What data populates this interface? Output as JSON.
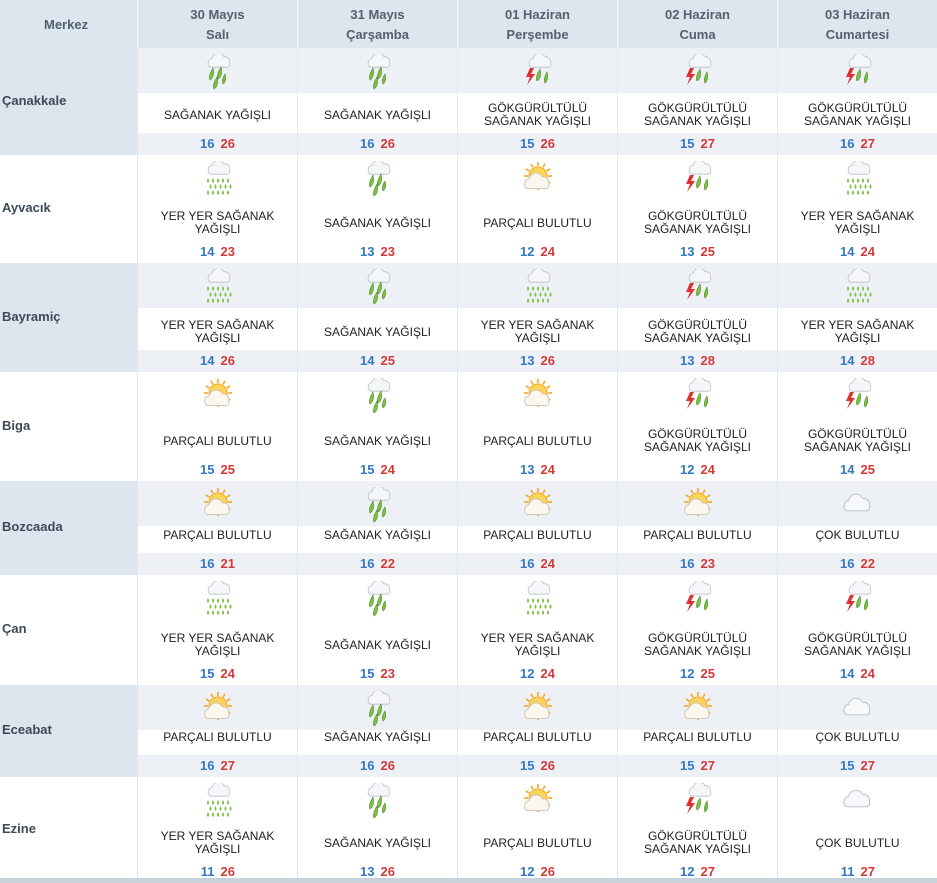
{
  "header": {
    "merkez_label": "Merkez",
    "days": [
      {
        "date": "30 Mayıs",
        "weekday": "Salı"
      },
      {
        "date": "31 Mayıs",
        "weekday": "Çarşamba"
      },
      {
        "date": "01 Haziran",
        "weekday": "Perşembe"
      },
      {
        "date": "02 Haziran",
        "weekday": "Cuma"
      },
      {
        "date": "03 Haziran",
        "weekday": "Cumartesi"
      }
    ]
  },
  "rows": [
    {
      "name": "Çanakkale",
      "days": [
        {
          "icon": "heavy-shower-icon",
          "desc": [
            "SAĞANAK YAĞIŞLI"
          ],
          "min": "16",
          "max": "26"
        },
        {
          "icon": "heavy-shower-icon",
          "desc": [
            "SAĞANAK YAĞIŞLI"
          ],
          "min": "16",
          "max": "26"
        },
        {
          "icon": "thunderstorm-icon",
          "desc": [
            "GÖKGÜRÜLTÜLÜ",
            "SAĞANAK YAĞIŞLI"
          ],
          "min": "15",
          "max": "26"
        },
        {
          "icon": "thunderstorm-icon",
          "desc": [
            "GÖKGÜRÜLTÜLÜ",
            "SAĞANAK YAĞIŞLI"
          ],
          "min": "15",
          "max": "27"
        },
        {
          "icon": "thunderstorm-icon",
          "desc": [
            "GÖKGÜRÜLTÜLÜ",
            "SAĞANAK YAĞIŞLI"
          ],
          "min": "16",
          "max": "27"
        }
      ]
    },
    {
      "name": "Ayvacık",
      "days": [
        {
          "icon": "scattered-shower-icon",
          "desc": [
            "YER YER SAĞANAK",
            "YAĞIŞLI"
          ],
          "min": "14",
          "max": "23"
        },
        {
          "icon": "heavy-shower-icon",
          "desc": [
            "SAĞANAK YAĞIŞLI"
          ],
          "min": "13",
          "max": "23"
        },
        {
          "icon": "partly-cloudy-icon",
          "desc": [
            "PARÇALI BULUTLU"
          ],
          "min": "12",
          "max": "24"
        },
        {
          "icon": "thunderstorm-icon",
          "desc": [
            "GÖKGÜRÜLTÜLÜ",
            "SAĞANAK YAĞIŞLI"
          ],
          "min": "13",
          "max": "25"
        },
        {
          "icon": "scattered-shower-icon",
          "desc": [
            "YER YER SAĞANAK",
            "YAĞIŞLI"
          ],
          "min": "14",
          "max": "24"
        }
      ]
    },
    {
      "name": "Bayramiç",
      "days": [
        {
          "icon": "scattered-shower-icon",
          "desc": [
            "YER YER SAĞANAK",
            "YAĞIŞLI"
          ],
          "min": "14",
          "max": "26"
        },
        {
          "icon": "heavy-shower-icon",
          "desc": [
            "SAĞANAK YAĞIŞLI"
          ],
          "min": "14",
          "max": "25"
        },
        {
          "icon": "scattered-shower-icon",
          "desc": [
            "YER YER SAĞANAK",
            "YAĞIŞLI"
          ],
          "min": "13",
          "max": "26"
        },
        {
          "icon": "thunderstorm-icon",
          "desc": [
            "GÖKGÜRÜLTÜLÜ",
            "SAĞANAK YAĞIŞLI"
          ],
          "min": "13",
          "max": "28"
        },
        {
          "icon": "scattered-shower-icon",
          "desc": [
            "YER YER SAĞANAK",
            "YAĞIŞLI"
          ],
          "min": "14",
          "max": "28"
        }
      ]
    },
    {
      "name": "Biga",
      "days": [
        {
          "icon": "partly-cloudy-icon",
          "desc": [
            "PARÇALI BULUTLU"
          ],
          "min": "15",
          "max": "25"
        },
        {
          "icon": "heavy-shower-icon",
          "desc": [
            "SAĞANAK YAĞIŞLI"
          ],
          "min": "15",
          "max": "24"
        },
        {
          "icon": "partly-cloudy-icon",
          "desc": [
            "PARÇALI BULUTLU"
          ],
          "min": "13",
          "max": "24"
        },
        {
          "icon": "thunderstorm-icon",
          "desc": [
            "GÖKGÜRÜLTÜLÜ",
            "SAĞANAK YAĞIŞLI"
          ],
          "min": "12",
          "max": "24"
        },
        {
          "icon": "thunderstorm-icon",
          "desc": [
            "GÖKGÜRÜLTÜLÜ",
            "SAĞANAK YAĞIŞLI"
          ],
          "min": "14",
          "max": "25"
        }
      ]
    },
    {
      "name": "Bozcaada",
      "days": [
        {
          "icon": "partly-cloudy-icon",
          "desc": [
            "PARÇALI BULUTLU"
          ],
          "min": "16",
          "max": "21"
        },
        {
          "icon": "heavy-shower-icon",
          "desc": [
            "SAĞANAK YAĞIŞLI"
          ],
          "min": "16",
          "max": "22"
        },
        {
          "icon": "partly-cloudy-icon",
          "desc": [
            "PARÇALI BULUTLU"
          ],
          "min": "16",
          "max": "24"
        },
        {
          "icon": "partly-cloudy-icon",
          "desc": [
            "PARÇALI BULUTLU"
          ],
          "min": "16",
          "max": "23"
        },
        {
          "icon": "cloudy-icon",
          "desc": [
            "ÇOK BULUTLU"
          ],
          "min": "16",
          "max": "22"
        }
      ]
    },
    {
      "name": "Çan",
      "days": [
        {
          "icon": "scattered-shower-icon",
          "desc": [
            "YER YER SAĞANAK",
            "YAĞIŞLI"
          ],
          "min": "15",
          "max": "24"
        },
        {
          "icon": "heavy-shower-icon",
          "desc": [
            "SAĞANAK YAĞIŞLI"
          ],
          "min": "15",
          "max": "23"
        },
        {
          "icon": "scattered-shower-icon",
          "desc": [
            "YER YER SAĞANAK",
            "YAĞIŞLI"
          ],
          "min": "12",
          "max": "24"
        },
        {
          "icon": "thunderstorm-icon",
          "desc": [
            "GÖKGÜRÜLTÜLÜ",
            "SAĞANAK YAĞIŞLI"
          ],
          "min": "12",
          "max": "25"
        },
        {
          "icon": "thunderstorm-icon",
          "desc": [
            "GÖKGÜRÜLTÜLÜ",
            "SAĞANAK YAĞIŞLI"
          ],
          "min": "14",
          "max": "24"
        }
      ]
    },
    {
      "name": "Eceabat",
      "days": [
        {
          "icon": "partly-cloudy-icon",
          "desc": [
            "PARÇALI BULUTLU"
          ],
          "min": "16",
          "max": "27"
        },
        {
          "icon": "heavy-shower-icon",
          "desc": [
            "SAĞANAK YAĞIŞLI"
          ],
          "min": "16",
          "max": "26"
        },
        {
          "icon": "partly-cloudy-icon",
          "desc": [
            "PARÇALI BULUTLU"
          ],
          "min": "15",
          "max": "26"
        },
        {
          "icon": "partly-cloudy-icon",
          "desc": [
            "PARÇALI BULUTLU"
          ],
          "min": "15",
          "max": "27"
        },
        {
          "icon": "cloudy-icon",
          "desc": [
            "ÇOK BULUTLU"
          ],
          "min": "15",
          "max": "27"
        }
      ]
    },
    {
      "name": "Ezine",
      "days": [
        {
          "icon": "scattered-shower-icon",
          "desc": [
            "YER YER SAĞANAK",
            "YAĞIŞLI"
          ],
          "min": "11",
          "max": "26"
        },
        {
          "icon": "heavy-shower-icon",
          "desc": [
            "SAĞANAK YAĞIŞLI"
          ],
          "min": "13",
          "max": "26"
        },
        {
          "icon": "partly-cloudy-icon",
          "desc": [
            "PARÇALI BULUTLU"
          ],
          "min": "12",
          "max": "26"
        },
        {
          "icon": "thunderstorm-icon",
          "desc": [
            "GÖKGÜRÜLTÜLÜ",
            "SAĞANAK YAĞIŞLI"
          ],
          "min": "12",
          "max": "27"
        },
        {
          "icon": "cloudy-icon",
          "desc": [
            "ÇOK BULUTLU"
          ],
          "min": "11",
          "max": "27"
        }
      ]
    }
  ],
  "colors": {
    "min_temp": "#3478c2",
    "max_temp": "#d23a3a",
    "header_bg": "#dde5ee",
    "rain_green": "#7cc142",
    "lightning_red": "#e03030",
    "sun": "#f5a623"
  }
}
